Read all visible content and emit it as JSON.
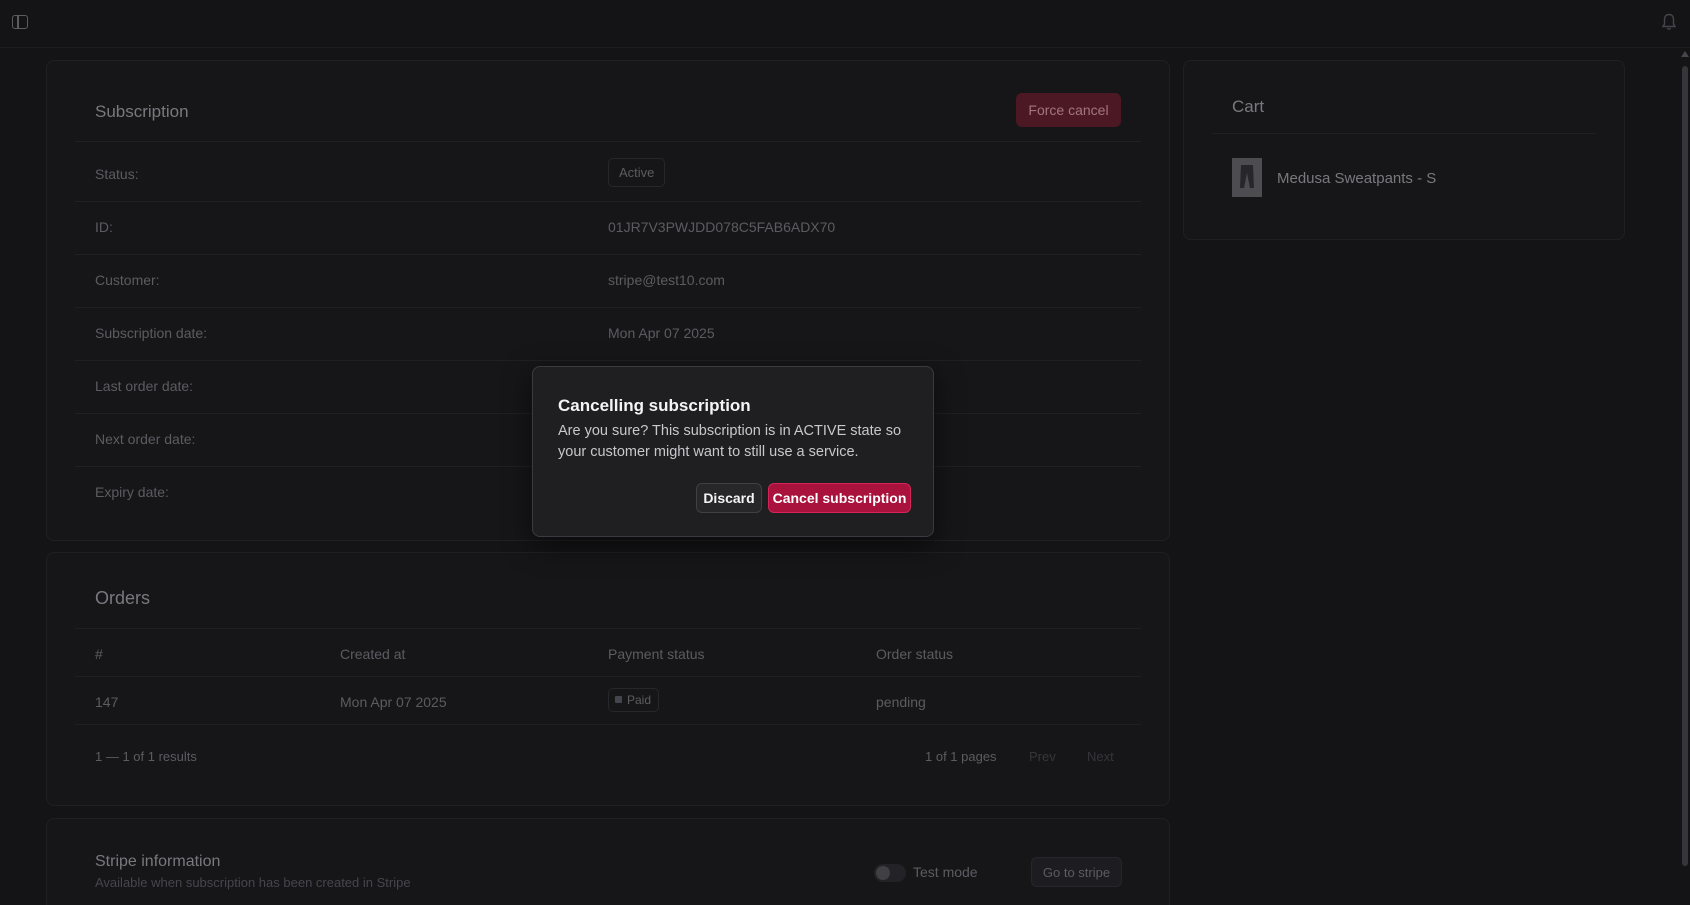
{
  "subscription": {
    "title": "Subscription",
    "force_cancel_label": "Force cancel",
    "rows": [
      {
        "label": "Status:",
        "value": "Active"
      },
      {
        "label": "ID:",
        "value": "01JR7V3PWJDD078C5FAB6ADX70"
      },
      {
        "label": "Customer:",
        "value": "stripe@test10.com"
      },
      {
        "label": "Subscription date:",
        "value": "Mon Apr 07 2025"
      },
      {
        "label": "Last order date:",
        "value": ""
      },
      {
        "label": "Next order date:",
        "value": ""
      },
      {
        "label": "Expiry date:",
        "value": ""
      }
    ]
  },
  "orders": {
    "title": "Orders",
    "columns": [
      "#",
      "Created at",
      "Payment status",
      "Order status"
    ],
    "rows": [
      {
        "number": "147",
        "created_at": "Mon Apr 07 2025",
        "payment_status": "Paid",
        "order_status": "pending"
      }
    ],
    "results_text": "1 — 1 of 1 results",
    "pages_text": "1 of 1 pages",
    "prev_label": "Prev",
    "next_label": "Next"
  },
  "stripe": {
    "title": "Stripe information",
    "subtitle": "Available when subscription has been created in Stripe",
    "test_mode_label": "Test mode",
    "go_to_stripe_label": "Go to stripe"
  },
  "cart": {
    "title": "Cart",
    "items": [
      {
        "name": "Medusa Sweatpants - S"
      }
    ]
  },
  "modal": {
    "title": "Cancelling subscription",
    "body": "Are you sure? This subscription is in ACTIVE state so your customer might want to still use a service.",
    "discard_label": "Discard",
    "confirm_label": "Cancel subscription"
  },
  "icons": {
    "sidebar": "sidebar-toggle-icon",
    "notifications": "bell-icon"
  },
  "colors": {
    "background": "#18181b",
    "danger": "#a8123c"
  }
}
